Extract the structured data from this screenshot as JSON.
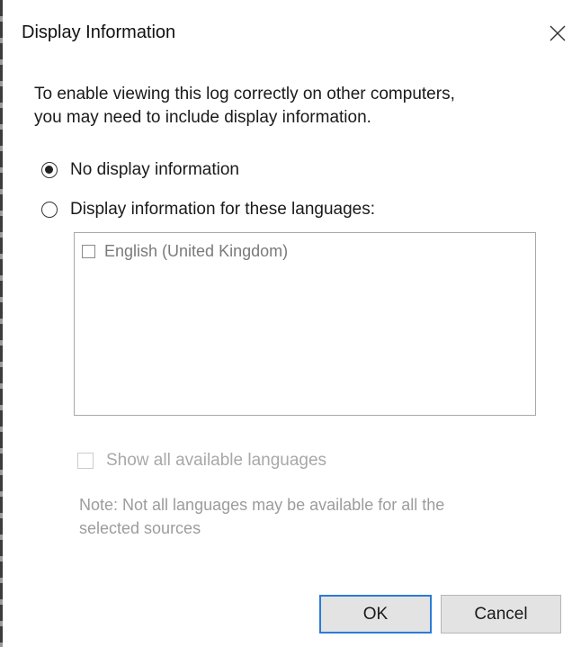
{
  "dialog": {
    "title": "Display Information",
    "intro_line1": "To enable viewing this log correctly on other computers,",
    "intro_line2": "you may need to include display information."
  },
  "options": {
    "no_display": {
      "label": "No display information",
      "selected": true
    },
    "display_for_languages": {
      "label": "Display information for these languages:",
      "selected": false
    }
  },
  "languages": [
    {
      "label": "English (United Kingdom)",
      "checked": false
    }
  ],
  "show_all": {
    "label": "Show all available languages",
    "checked": false,
    "enabled": false
  },
  "note": {
    "line1": "Note: Not all languages may be available for all the",
    "line2": "selected sources"
  },
  "buttons": {
    "ok": "OK",
    "cancel": "Cancel"
  },
  "colors": {
    "accent": "#2b7bd6",
    "disabled_text": "#a8a8a8"
  },
  "icons": {
    "close": "close-icon"
  }
}
